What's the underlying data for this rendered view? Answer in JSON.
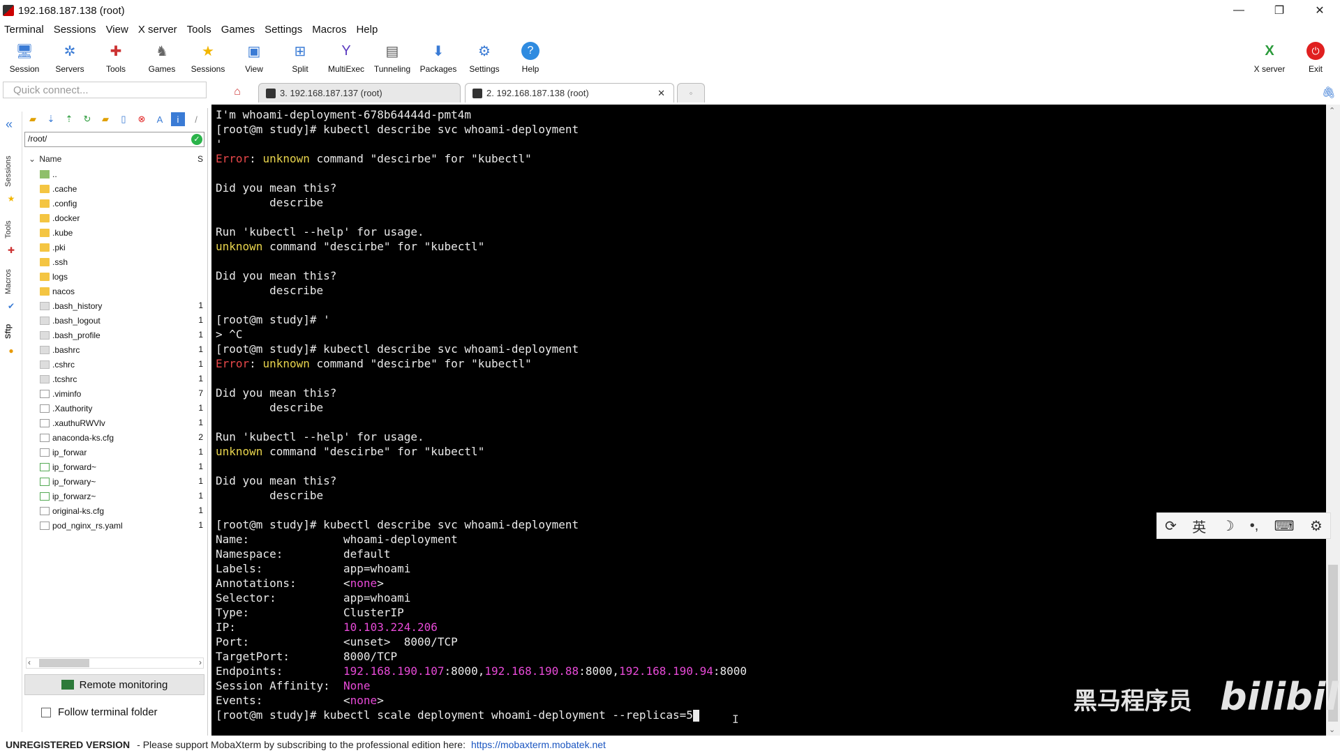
{
  "window": {
    "title": "192.168.187.138 (root)",
    "controls": [
      "—",
      "❐",
      "✕"
    ]
  },
  "menu": [
    "Terminal",
    "Sessions",
    "View",
    "X server",
    "Tools",
    "Games",
    "Settings",
    "Macros",
    "Help"
  ],
  "toolbar": {
    "items": [
      {
        "label": "Session",
        "icon": "monitor-icon"
      },
      {
        "label": "Servers",
        "icon": "servers-icon"
      },
      {
        "label": "Tools",
        "icon": "tools-icon"
      },
      {
        "label": "Games",
        "icon": "games-icon"
      },
      {
        "label": "Sessions",
        "icon": "star-icon"
      },
      {
        "label": "View",
        "icon": "view-icon"
      },
      {
        "label": "Split",
        "icon": "split-icon"
      },
      {
        "label": "MultiExec",
        "icon": "multiexec-icon"
      },
      {
        "label": "Tunneling",
        "icon": "tunneling-icon"
      },
      {
        "label": "Packages",
        "icon": "packages-icon"
      },
      {
        "label": "Settings",
        "icon": "settings-icon"
      },
      {
        "label": "Help",
        "icon": "help-icon"
      }
    ],
    "xserver_label": "X server",
    "exit_label": "Exit"
  },
  "quick_connect": {
    "placeholder": "Quick connect..."
  },
  "tabs": [
    {
      "label": "3. 192.168.187.137 (root)",
      "active": false
    },
    {
      "label": "2. 192.168.187.138 (root)",
      "active": true
    }
  ],
  "side_tabs": [
    "Sessions",
    "Tools",
    "Macros",
    "Sftp"
  ],
  "sftp": {
    "path": "/root/",
    "column_name": "Name",
    "column_size": "S",
    "files": [
      {
        "name": "..",
        "type": "folderup",
        "size": ""
      },
      {
        "name": ".cache",
        "type": "folder",
        "size": ""
      },
      {
        "name": ".config",
        "type": "folder",
        "size": ""
      },
      {
        "name": ".docker",
        "type": "folder",
        "size": ""
      },
      {
        "name": ".kube",
        "type": "folder",
        "size": ""
      },
      {
        "name": ".pki",
        "type": "folder",
        "size": ""
      },
      {
        "name": ".ssh",
        "type": "folder",
        "size": ""
      },
      {
        "name": "logs",
        "type": "folder",
        "size": ""
      },
      {
        "name": "nacos",
        "type": "folder",
        "size": ""
      },
      {
        "name": ".bash_history",
        "type": "hidden",
        "size": "1"
      },
      {
        "name": ".bash_logout",
        "type": "hidden",
        "size": "1"
      },
      {
        "name": ".bash_profile",
        "type": "hidden",
        "size": "1"
      },
      {
        "name": ".bashrc",
        "type": "hidden",
        "size": "1"
      },
      {
        "name": ".cshrc",
        "type": "hidden",
        "size": "1"
      },
      {
        "name": ".tcshrc",
        "type": "hidden",
        "size": "1"
      },
      {
        "name": ".viminfo",
        "type": "doc",
        "size": "7"
      },
      {
        "name": ".Xauthority",
        "type": "doc",
        "size": "1"
      },
      {
        "name": ".xauthuRWVlv",
        "type": "doc",
        "size": "1"
      },
      {
        "name": "anaconda-ks.cfg",
        "type": "doc",
        "size": "2"
      },
      {
        "name": "ip_forwar",
        "type": "doc",
        "size": "1"
      },
      {
        "name": "ip_forward~",
        "type": "green",
        "size": "1"
      },
      {
        "name": "ip_forwary~",
        "type": "green",
        "size": "1"
      },
      {
        "name": "ip_forwarz~",
        "type": "green",
        "size": "1"
      },
      {
        "name": "original-ks.cfg",
        "type": "doc",
        "size": "1"
      },
      {
        "name": "pod_nginx_rs.yaml",
        "type": "doc",
        "size": "1"
      }
    ],
    "remote_monitoring_label": "Remote monitoring",
    "follow_label": "Follow terminal folder"
  },
  "terminal": {
    "lines": [
      [
        {
          "t": "I'm whoami-deployment-678b64444d-pmt4m",
          "c": ""
        }
      ],
      [
        {
          "t": "[root@m study]# kubectl describe svc whoami-deployment",
          "c": ""
        }
      ],
      [
        {
          "t": "'",
          "c": ""
        }
      ],
      [
        {
          "t": "Error",
          "c": "red"
        },
        {
          "t": ": ",
          "c": ""
        },
        {
          "t": "unknown",
          "c": "yellow"
        },
        {
          "t": " command \"descirbe\" for \"kubectl\"",
          "c": ""
        }
      ],
      [
        {
          "t": "",
          "c": ""
        }
      ],
      [
        {
          "t": "Did you mean this?",
          "c": ""
        }
      ],
      [
        {
          "t": "        describe",
          "c": ""
        }
      ],
      [
        {
          "t": "",
          "c": ""
        }
      ],
      [
        {
          "t": "Run 'kubectl --help' for usage.",
          "c": ""
        }
      ],
      [
        {
          "t": "unknown",
          "c": "yellow"
        },
        {
          "t": " command \"descirbe\" for \"kubectl\"",
          "c": ""
        }
      ],
      [
        {
          "t": "",
          "c": ""
        }
      ],
      [
        {
          "t": "Did you mean this?",
          "c": ""
        }
      ],
      [
        {
          "t": "        describe",
          "c": ""
        }
      ],
      [
        {
          "t": "",
          "c": ""
        }
      ],
      [
        {
          "t": "[root@m study]# '",
          "c": ""
        }
      ],
      [
        {
          "t": "> ^C",
          "c": ""
        }
      ],
      [
        {
          "t": "[root@m study]# kubectl describe svc whoami-deployment",
          "c": ""
        }
      ],
      [
        {
          "t": "Error",
          "c": "red"
        },
        {
          "t": ": ",
          "c": ""
        },
        {
          "t": "unknown",
          "c": "yellow"
        },
        {
          "t": " command \"descirbe\" for \"kubectl\"",
          "c": ""
        }
      ],
      [
        {
          "t": "",
          "c": ""
        }
      ],
      [
        {
          "t": "Did you mean this?",
          "c": ""
        }
      ],
      [
        {
          "t": "        describe",
          "c": ""
        }
      ],
      [
        {
          "t": "",
          "c": ""
        }
      ],
      [
        {
          "t": "Run 'kubectl --help' for usage.",
          "c": ""
        }
      ],
      [
        {
          "t": "unknown",
          "c": "yellow"
        },
        {
          "t": " command \"descirbe\" for \"kubectl\"",
          "c": ""
        }
      ],
      [
        {
          "t": "",
          "c": ""
        }
      ],
      [
        {
          "t": "Did you mean this?",
          "c": ""
        }
      ],
      [
        {
          "t": "        describe",
          "c": ""
        }
      ],
      [
        {
          "t": "",
          "c": ""
        }
      ],
      [
        {
          "t": "[root@m study]# kubectl describe svc whoami-deployment",
          "c": ""
        }
      ],
      [
        {
          "t": "Name:              whoami-deployment",
          "c": ""
        }
      ],
      [
        {
          "t": "Namespace:         default",
          "c": ""
        }
      ],
      [
        {
          "t": "Labels:            app=whoami",
          "c": ""
        }
      ],
      [
        {
          "t": "Annotations:       <",
          "c": ""
        },
        {
          "t": "none",
          "c": "mag"
        },
        {
          "t": ">",
          "c": ""
        }
      ],
      [
        {
          "t": "Selector:          app=whoami",
          "c": ""
        }
      ],
      [
        {
          "t": "Type:              ClusterIP",
          "c": ""
        }
      ],
      [
        {
          "t": "IP:                ",
          "c": ""
        },
        {
          "t": "10.103.224.206",
          "c": "mag"
        }
      ],
      [
        {
          "t": "Port:              <unset>  8000/TCP",
          "c": ""
        }
      ],
      [
        {
          "t": "TargetPort:        8000/TCP",
          "c": ""
        }
      ],
      [
        {
          "t": "Endpoints:         ",
          "c": ""
        },
        {
          "t": "192.168.190.107",
          "c": "mag"
        },
        {
          "t": ":8000,",
          "c": ""
        },
        {
          "t": "192.168.190.88",
          "c": "mag"
        },
        {
          "t": ":8000,",
          "c": ""
        },
        {
          "t": "192.168.190.94",
          "c": "mag"
        },
        {
          "t": ":8000",
          "c": ""
        }
      ],
      [
        {
          "t": "Session Affinity:  ",
          "c": ""
        },
        {
          "t": "None",
          "c": "mag"
        }
      ],
      [
        {
          "t": "Events:            <",
          "c": ""
        },
        {
          "t": "none",
          "c": "mag"
        },
        {
          "t": ">",
          "c": ""
        }
      ],
      [
        {
          "t": "[root@m study]# kubectl scale deployment whoami-deployment --replicas=5",
          "c": ""
        }
      ]
    ]
  },
  "ime": [
    "⟳",
    "英",
    "☽",
    "•,",
    "⌨",
    "⚙"
  ],
  "watermark": {
    "text": "黑马程序员",
    "logo": "bilibili"
  },
  "status": {
    "unregistered": "UNREGISTERED VERSION",
    "message": "-  Please support MobaXterm by subscribing to the professional edition here:",
    "link": "https://mobaxterm.mobatek.net"
  },
  "colors": {
    "error": "#e8484a",
    "keyword": "#e8d44d",
    "value": "#e84ad8",
    "accent": "#3a7bd5"
  }
}
